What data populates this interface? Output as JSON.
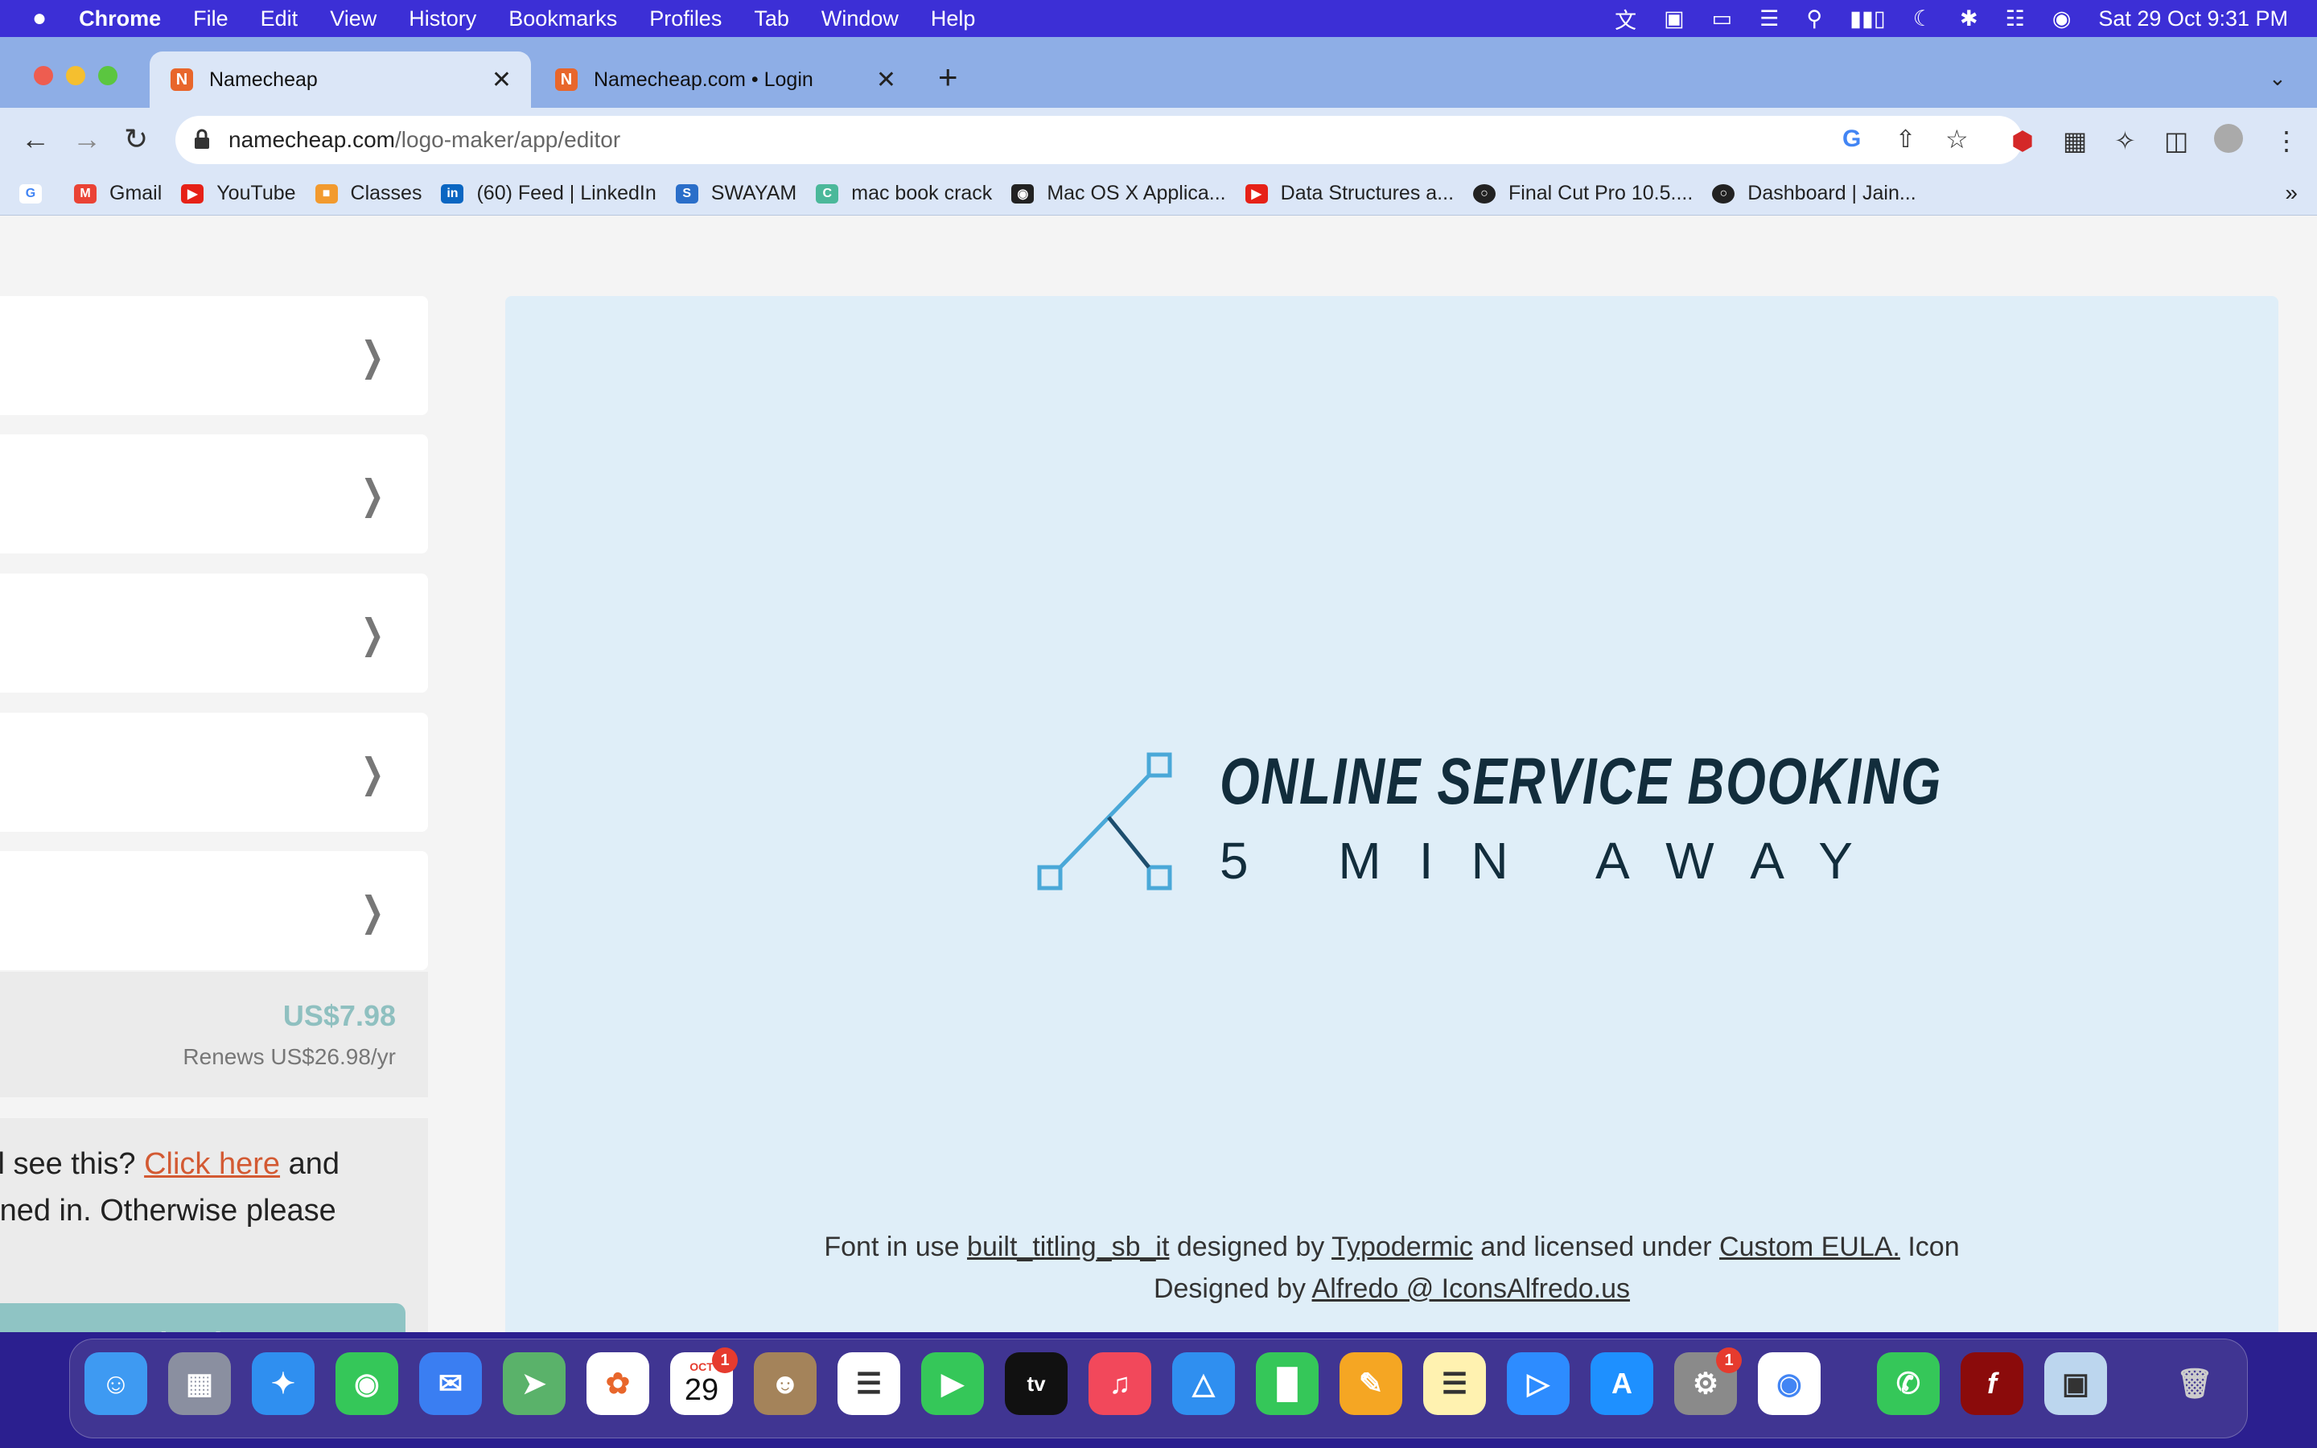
{
  "menubar": {
    "apple": "",
    "app": "Chrome",
    "items": [
      "File",
      "Edit",
      "View",
      "History",
      "Bookmarks",
      "Profiles",
      "Tab",
      "Window",
      "Help"
    ],
    "datetime": "Sat 29 Oct  9:31 PM"
  },
  "tabs": [
    {
      "title": "Namecheap",
      "favicon": "N"
    },
    {
      "title": "Namecheap.com • Login",
      "favicon": "N"
    }
  ],
  "address": {
    "host": "namecheap.com",
    "path": "/logo-maker/app/editor"
  },
  "bookmarks": [
    {
      "label": "",
      "icon": "google-icon",
      "color": "#4285f4"
    },
    {
      "label": "Gmail",
      "icon": "gmail-icon",
      "color": "#ea4335"
    },
    {
      "label": "YouTube",
      "icon": "youtube-icon",
      "color": "#e62117"
    },
    {
      "label": "Classes",
      "icon": "classroom-icon",
      "color": "#f29a2e"
    },
    {
      "label": "(60) Feed | LinkedIn",
      "icon": "linkedin-icon",
      "color": "#0a66c2"
    },
    {
      "label": "SWAYAM",
      "icon": "swayam-icon",
      "color": "#2a6ec9"
    },
    {
      "label": "mac book crack",
      "icon": "bookmark-icon",
      "color": "#4bb89a"
    },
    {
      "label": "Mac OS X Applica...",
      "icon": "bookmark-icon",
      "color": "#222"
    },
    {
      "label": "Data Structures a...",
      "icon": "youtube-icon",
      "color": "#e62117"
    },
    {
      "label": "Final Cut Pro 10.5....",
      "icon": "globe-icon",
      "color": "#222"
    },
    {
      "label": "Dashboard | Jain...",
      "icon": "globe-icon",
      "color": "#222"
    }
  ],
  "sidebar": {
    "price": "US$7.98",
    "renews": "Renews US$26.98/yr",
    "notice_pre": "till see this? ",
    "notice_link": "Click here",
    "notice_post": " and",
    "notice_line2": "igned in. Otherwise please",
    "download_label": "In to Download"
  },
  "preview": {
    "title": "ONLINE SERVICE BOOKING",
    "tagline": "5 MIN AWAY",
    "credit": {
      "font_pre": "Font in use ",
      "font_name": "built_titling_sb_it",
      "by": " designed by ",
      "designer": "Typodermic",
      "lic": " and licensed under ",
      "license": "Custom EULA.",
      "icon": " Icon",
      "icon_by": "Designed by ",
      "icon_designer": "Alfredo @ IconsAlfredo.us"
    }
  },
  "dock": {
    "calendar_month": "OCT",
    "calendar_day": "29",
    "calendar_badge": "1",
    "settings_badge": "1"
  },
  "colors": {
    "accent": "#d35a33",
    "logo_icon": "#4aa8d8",
    "logo_text": "#122d3c"
  }
}
